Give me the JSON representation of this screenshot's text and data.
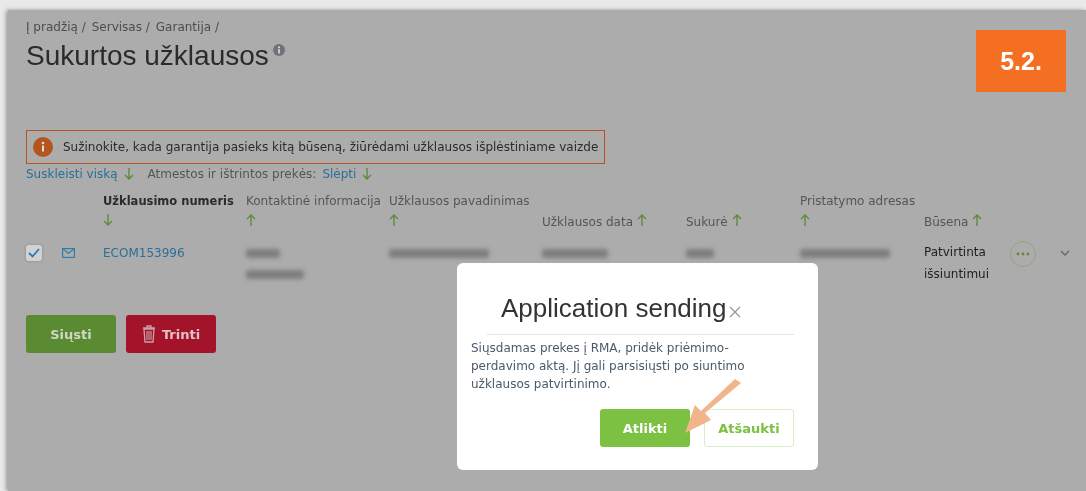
{
  "breadcrumbs": [
    "Į pradžią /",
    "Servisas /",
    "Garantija /"
  ],
  "title": "Sukurtos užklausos",
  "step_badge": "5.2.",
  "notice": "Sužinokite, kada garantija pasieks kitą būseną, žiūrėdami užklausos išplėstiniame vaizde",
  "toolbar": {
    "collapse_link": "Suskleisti viską",
    "filter_label": "Atmestos ir ištrintos prekės:",
    "filter_link": "Slėpti"
  },
  "table": {
    "columns": [
      {
        "label": "Užklausimo numeris",
        "selected": true
      },
      {
        "label": "Kontaktinė informacija",
        "selected": false
      },
      {
        "label": "Užklausos pavadinimas",
        "selected": false
      },
      {
        "label": "Užklausos data",
        "selected": false
      },
      {
        "label": "Sukurė",
        "selected": false
      },
      {
        "label": "Pristatymo adresas",
        "selected": false
      },
      {
        "label": "Būsena",
        "selected": false
      }
    ],
    "rows": [
      {
        "checked": true,
        "number": "ECOM153996",
        "status": "Patvirtinta išsiuntimui"
      }
    ]
  },
  "actions": [
    {
      "label": "Siųsti",
      "kind": "send"
    },
    {
      "label": "Trinti",
      "kind": "delete"
    }
  ],
  "dialog": {
    "title": "Application sending",
    "body": "Siųsdamas prekes į RMA, pridėk priėmimo-perdavimo aktą. Jį gali parsisiųsti po siuntimo užklausos patvirtinimo.",
    "buttons": [
      {
        "label": "Atlikti",
        "kind": "primary"
      },
      {
        "label": "Atšaukti",
        "kind": "secondary"
      }
    ]
  }
}
